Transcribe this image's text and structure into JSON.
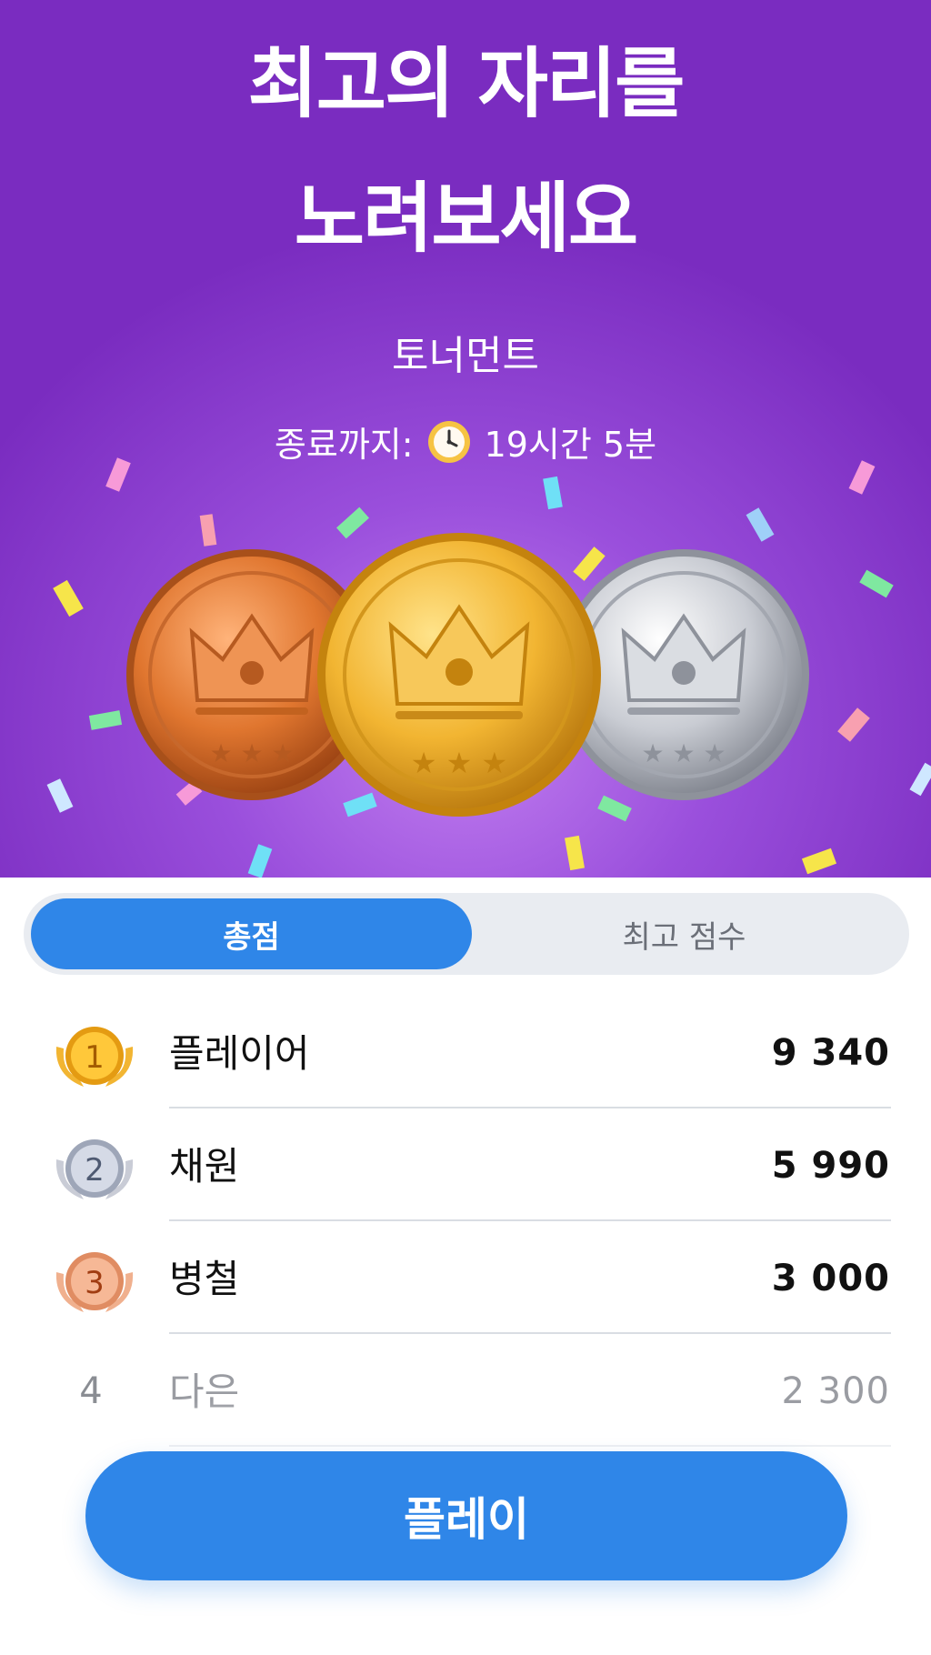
{
  "hero": {
    "headline_line1": "최고의 자리를",
    "headline_line2": "노려보세요",
    "subtitle": "토너먼트",
    "timer_label": "종료까지:",
    "timer_value": "19시간 5분",
    "clock_icon": "clock-icon",
    "background_color": "#8a3fd0"
  },
  "tabs": {
    "total_label": "총점",
    "best_label": "최고 점수",
    "active": "total"
  },
  "leaderboard": [
    {
      "rank": "1",
      "name": "플레이어",
      "score": "9 340",
      "badge": "gold"
    },
    {
      "rank": "2",
      "name": "채원",
      "score": "5 990",
      "badge": "silver"
    },
    {
      "rank": "3",
      "name": "병철",
      "score": "3 000",
      "badge": "bronze"
    },
    {
      "rank": "4",
      "name": "다은",
      "score": "2 300",
      "badge": "none"
    }
  ],
  "play_button": {
    "label": "플레이",
    "color": "#2f86e8"
  }
}
